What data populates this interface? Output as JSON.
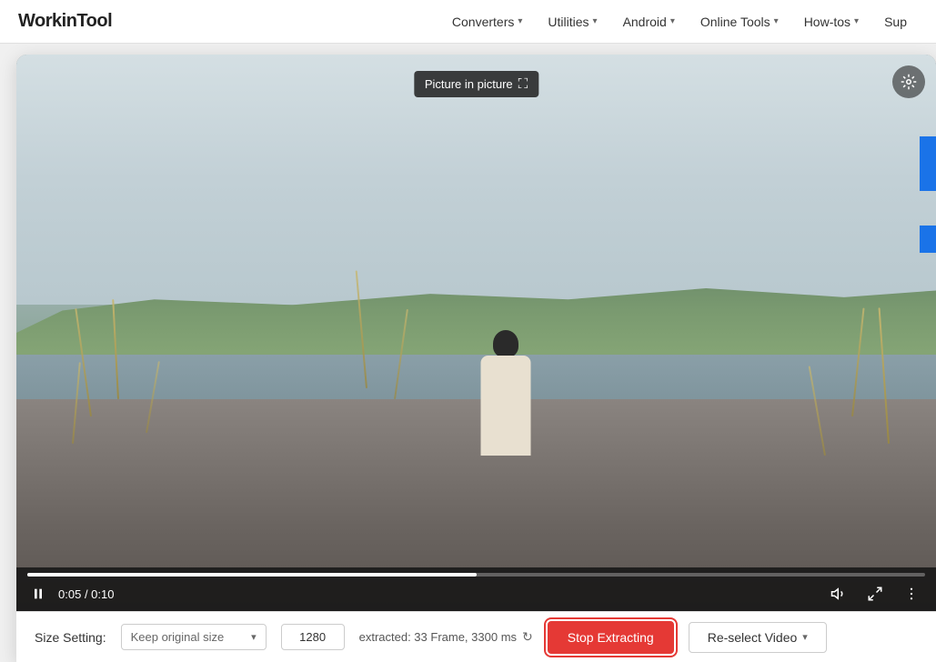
{
  "navbar": {
    "logo": "WorkinTool",
    "links": [
      {
        "label": "Converters",
        "chevron": "▾"
      },
      {
        "label": "Utilities",
        "chevron": "▾"
      },
      {
        "label": "Android",
        "chevron": "▾"
      },
      {
        "label": "Online Tools",
        "chevron": "▾"
      },
      {
        "label": "How-tos",
        "chevron": "▾"
      },
      {
        "label": "Sup",
        "chevron": ""
      }
    ]
  },
  "video": {
    "pip_tooltip": "Picture in picture",
    "pip_icon": "⛶",
    "time_current": "0:05",
    "time_total": "0:10",
    "progress_percent": 50
  },
  "bottom_bar": {
    "size_setting_label": "Size Setting:",
    "size_dropdown_value": "Keep original size",
    "size_input_value": "1280",
    "extracted_info": "extracted: 33 Frame, 3300 ms",
    "stop_btn_label": "Stop Extracting",
    "reselect_btn_label": "Re-select Video"
  }
}
